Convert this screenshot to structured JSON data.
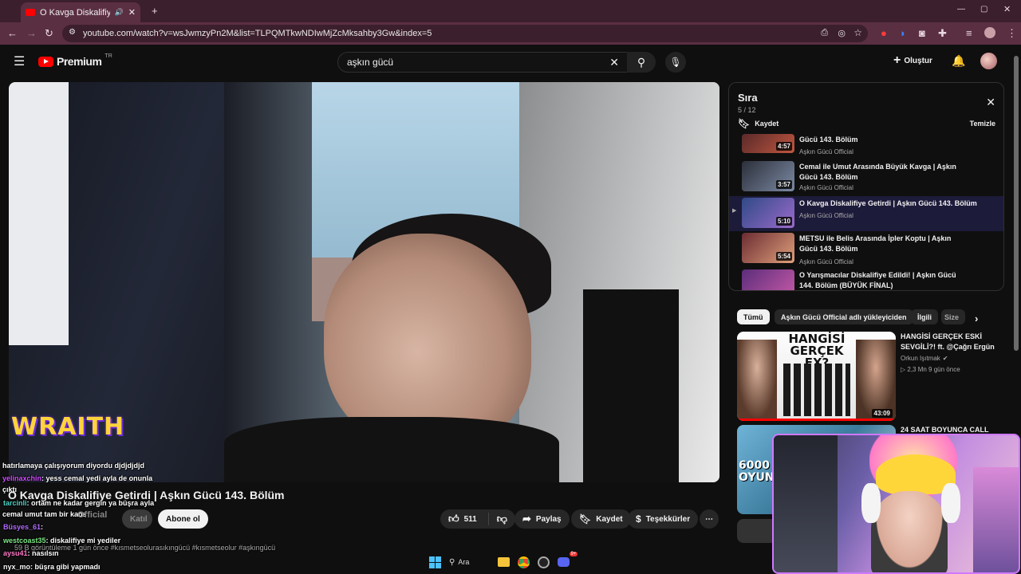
{
  "browser": {
    "tab_title": "O Kavga Diskalifiye Getirdi |",
    "url": "youtube.com/watch?v=wsJwmzyPn2M&list=TLPQMTkwNDIwMjZcMksahby3Gw&index=5"
  },
  "header": {
    "logo": "Premium",
    "logo_badge": "TR",
    "search_value": "aşkın gücü",
    "create_label": "Oluştur"
  },
  "video": {
    "overlay_logo": "WRAITH",
    "title": "O Kavga Diskalifiye Getirdi | Aşkın Gücü 143. Bölüm",
    "channel_partial": "Official",
    "join_label": "Katıl",
    "subscribe_label": "Abone ol",
    "likes": "511",
    "share_label": "Paylaş",
    "save_label": "Kaydet",
    "thanks_label": "Teşekkürler",
    "meta_partial": "59 B görüntüleme  1 gün önce  #kısmetseolurasıkıngücü #kısmetseolur #aşkıngücü"
  },
  "chat": [
    {
      "user": "",
      "text": "hatırlamaya çalışıyorum diyordu djdjdjdjd"
    },
    {
      "user": "yelinaxchin",
      "text": ": yess cemal yedi ayla de onunla"
    },
    {
      "user": "",
      "text": "çıktı"
    },
    {
      "user": "tarcinli",
      "text": ": ortam ne kadar gergin ya büşra ayla"
    },
    {
      "user": "",
      "text": "cemal umut tam bir kaos"
    },
    {
      "user": "Büsyes_61",
      "text": ":"
    },
    {
      "user": "westcoast35",
      "text": ": diskalifiye mi yediler"
    },
    {
      "user": "aysu41",
      "text": ": nasılsın"
    },
    {
      "user": "nyx_mo",
      "text": ": büşra gibi yapmadı"
    }
  ],
  "queue": {
    "title": "Sıra",
    "position": "5 / 12",
    "save_label": "Kaydet",
    "clear_label": "Temizle",
    "items": [
      {
        "title": "Gücü 143. Bölüm",
        "channel": "Aşkın Gücü Official",
        "duration": "4:57",
        "active": false
      },
      {
        "title": "Cemal ile Umut Arasında Büyük Kavga | Aşkın Gücü 143. Bölüm",
        "channel": "Aşkın Gücü Official",
        "duration": "3:57",
        "active": false
      },
      {
        "title": "O Kavga Diskalifiye Getirdi | Aşkın Gücü 143. Bölüm",
        "channel": "Aşkın Gücü Official",
        "duration": "5:10",
        "active": true
      },
      {
        "title": "METSU ile Belis Arasında İpler Koptu | Aşkın Gücü 143. Bölüm",
        "channel": "Aşkın Gücü Official",
        "duration": "5:54",
        "active": false
      },
      {
        "title": "O Yarışmacılar Diskalifiye Edildi! | Aşkın Gücü 144. Bölüm (BÜYÜK FİNAL)",
        "channel": "",
        "duration": "",
        "active": false
      }
    ]
  },
  "chips": [
    "Tümü",
    "Aşkın Gücü Official adlı yükleyiciden",
    "İlgili",
    "Size"
  ],
  "recommendations": [
    {
      "title": "HANGİSİ GERÇEK ESKİ SEVGİLİ?! ft. @Çağrı Ergün",
      "channel": "Orkun Işıtmak",
      "meta": "2,3 Mn  9 gün önce",
      "duration": "43:09",
      "thumb_text": "HANGİSİ GERÇEK EX?"
    },
    {
      "title": "24 SAAT BOYUNCA CALL",
      "channel": "",
      "meta": "",
      "duration": "",
      "thumb_text": "6000 OYUN"
    }
  ],
  "taskbar": {
    "search_label": "Ara",
    "badge": "9+"
  },
  "colors": {
    "accent": "#ff0000",
    "active_row": "#1d1b3a",
    "overlay_logo": "#ffd43b"
  }
}
